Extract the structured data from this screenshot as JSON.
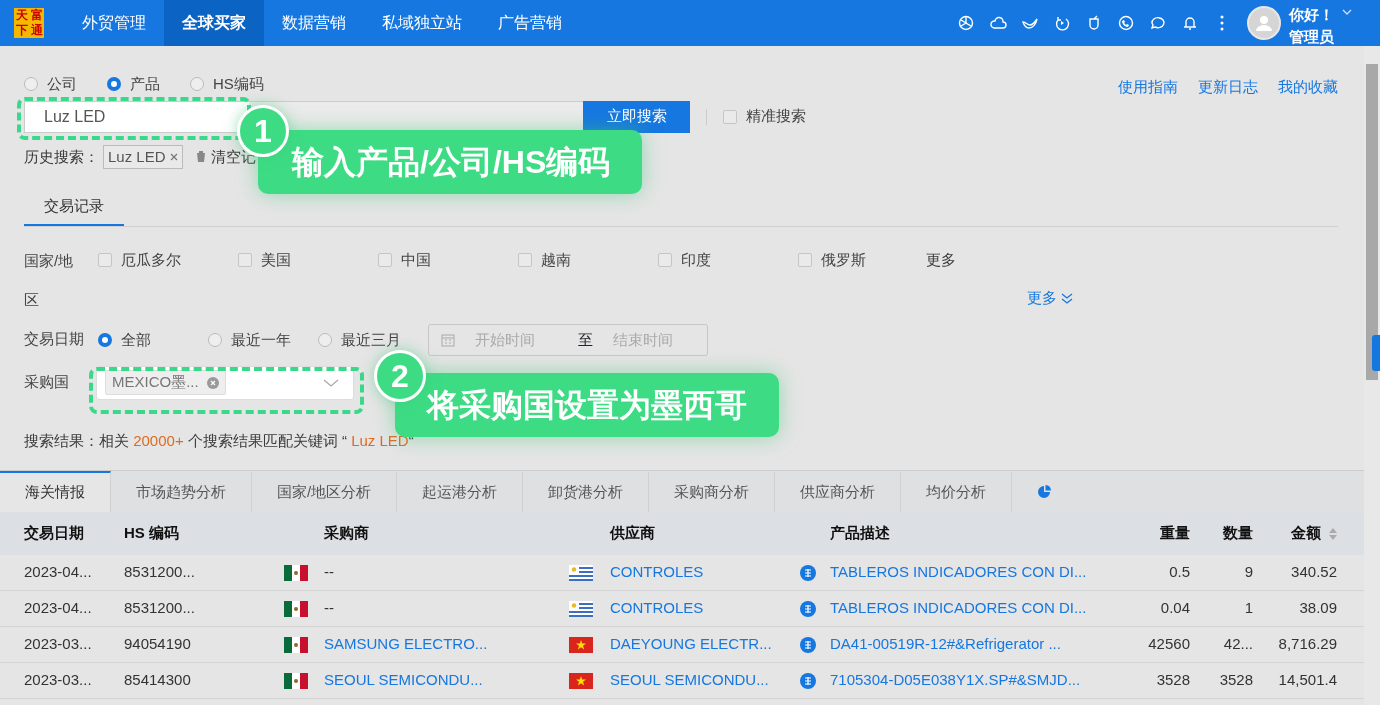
{
  "logo": {
    "chars": [
      "天",
      "富",
      "下",
      "通"
    ]
  },
  "nav": [
    {
      "label": "外贸管理",
      "selected": false
    },
    {
      "label": "全球买家",
      "selected": true
    },
    {
      "label": "数据营销",
      "selected": false
    },
    {
      "label": "私域独立站",
      "selected": false
    },
    {
      "label": "广告营销",
      "selected": false
    }
  ],
  "user": {
    "greeting": "你好！",
    "role": "管理员"
  },
  "search_type": [
    {
      "label": "公司",
      "selected": false
    },
    {
      "label": "产品",
      "selected": true
    },
    {
      "label": "HS编码",
      "selected": false
    }
  ],
  "top_links": [
    "使用指南",
    "更新日志",
    "我的收藏"
  ],
  "search": {
    "value": "Luz LED",
    "button": "立即搜索",
    "exact": {
      "label": "精准搜索",
      "checked": false
    }
  },
  "history": {
    "label": "历史搜索：",
    "items": [
      "Luz LED"
    ],
    "clear": "清空记"
  },
  "sub_tabs": [
    {
      "label": "交易记录",
      "selected": true
    }
  ],
  "filters": {
    "country_label": "国家/地区",
    "countries": [
      {
        "label": "厄瓜多尔",
        "checked": false
      },
      {
        "label": "美国",
        "checked": false
      },
      {
        "label": "中国",
        "checked": false
      },
      {
        "label": "越南",
        "checked": false
      },
      {
        "label": "印度",
        "checked": false
      },
      {
        "label": "俄罗斯",
        "checked": false
      }
    ],
    "country_more": "更多",
    "more": "更多",
    "date_label": "交易日期",
    "date_options": [
      {
        "label": "全部",
        "selected": true
      },
      {
        "label": "最近一年",
        "selected": false
      },
      {
        "label": "最近三月",
        "selected": false
      }
    ],
    "start_placeholder": "开始时间",
    "to": "至",
    "end_placeholder": "结束时间",
    "buyer_country_label": "采购国",
    "buyer_country_tags": [
      "MEXICO墨..."
    ]
  },
  "result": {
    "prefix": "搜索结果：相关",
    "count": "20000+",
    "middle": "个搜索结果匹配关键词",
    "open_quote": "“",
    "keyword": "Luz LED",
    "close_quote": "“"
  },
  "callouts": [
    {
      "number": "1",
      "text": "输入产品/公司/HS编码"
    },
    {
      "number": "2",
      "text": "将采购国设置为墨西哥"
    }
  ],
  "analysis_tabs": [
    {
      "label": "海关情报",
      "selected": true
    },
    {
      "label": "市场趋势分析",
      "selected": false
    },
    {
      "label": "国家/地区分析",
      "selected": false
    },
    {
      "label": "起运港分析",
      "selected": false
    },
    {
      "label": "卸货港分析",
      "selected": false
    },
    {
      "label": "采购商分析",
      "selected": false
    },
    {
      "label": "供应商分析",
      "selected": false
    },
    {
      "label": "均价分析",
      "selected": false
    }
  ],
  "table": {
    "columns": [
      "交易日期",
      "HS 编码",
      "采购商",
      "供应商",
      "产品描述",
      "重量",
      "数量",
      "金额"
    ],
    "rows": [
      {
        "date": "2023-04...",
        "hs": "8531200...",
        "buyer_flag": {
          "kind": "mexico"
        },
        "buyer": "--",
        "buyer_linked": false,
        "supplier_flag": {
          "kind": "uruguay"
        },
        "supplier": "CONTROLES",
        "product": "TABLEROS INDICADORES CON DI...",
        "weight": "0.5",
        "quantity": "9",
        "amount": "340.52"
      },
      {
        "date": "2023-04...",
        "hs": "8531200...",
        "buyer_flag": {
          "kind": "mexico"
        },
        "buyer": "--",
        "buyer_linked": false,
        "supplier_flag": {
          "kind": "uruguay"
        },
        "supplier": "CONTROLES",
        "product": "TABLEROS INDICADORES CON DI...",
        "weight": "0.04",
        "quantity": "1",
        "amount": "38.09"
      },
      {
        "date": "2023-03...",
        "hs": "94054190",
        "buyer_flag": {
          "kind": "mexico"
        },
        "buyer": "SAMSUNG ELECTRO...",
        "buyer_linked": true,
        "supplier_flag": {
          "kind": "vietnam"
        },
        "supplier": "DAEYOUNG ELECTR...",
        "product": "DA41-00519R-12#&Refrigerator ...",
        "weight": "42560",
        "quantity": "42...",
        "amount": "8,716.29"
      },
      {
        "date": "2023-03...",
        "hs": "85414300",
        "buyer_flag": {
          "kind": "mexico"
        },
        "buyer": "SEOUL SEMICONDU...",
        "buyer_linked": true,
        "supplier_flag": {
          "kind": "vietnam"
        },
        "supplier": "SEOUL SEMICONDU...",
        "product": "7105304-D05E038Y1X.SP#&SMJD...",
        "weight": "3528",
        "quantity": "3528",
        "amount": "14,501.4"
      }
    ]
  }
}
